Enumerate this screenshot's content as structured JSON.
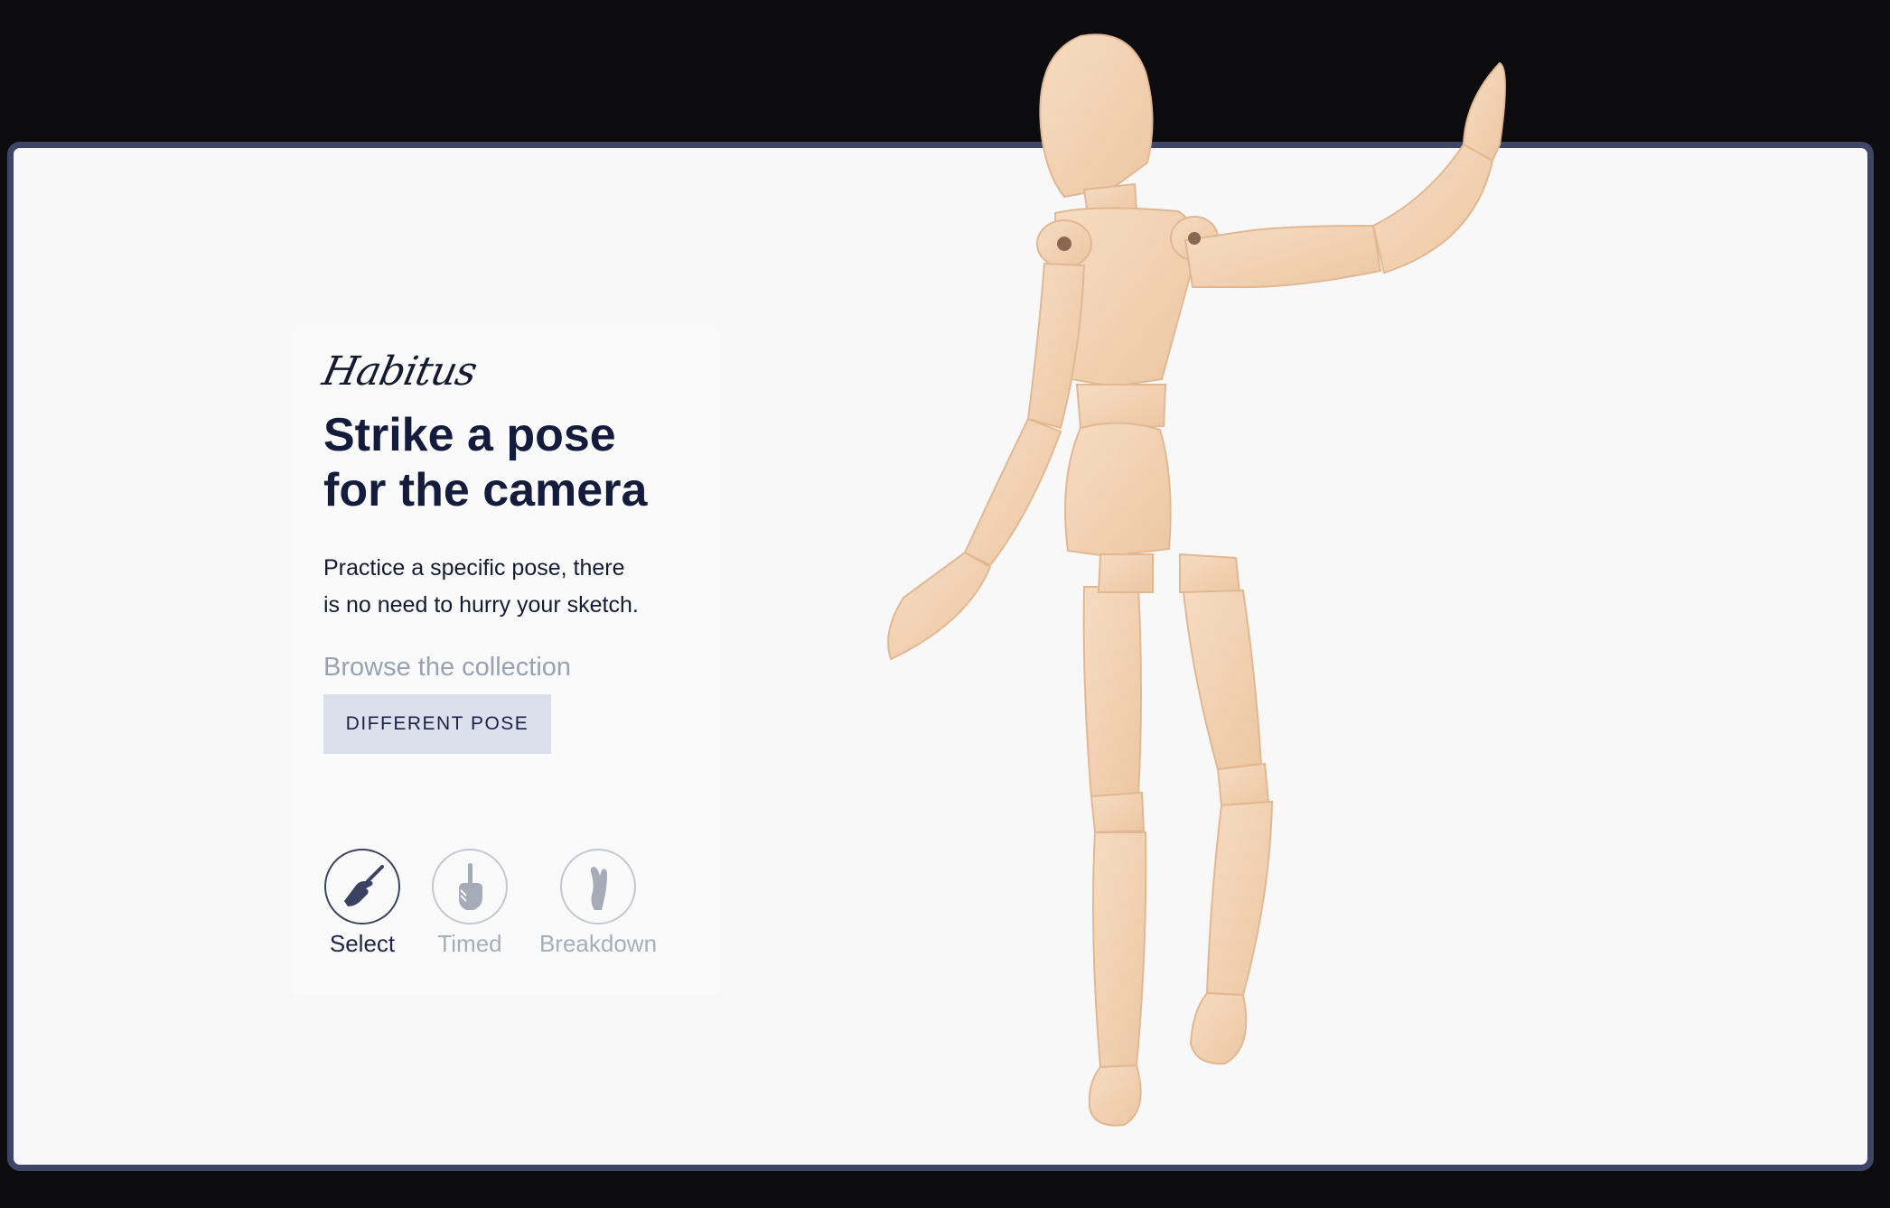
{
  "brand": "Habitus",
  "hero": {
    "headline_line1": "Strike a pose",
    "headline_line2": "for the camera",
    "description_line1": "Practice a specific pose, there",
    "description_line2": "is no need to hurry your sketch.",
    "browse_link": "Browse the collection",
    "button_label": "DIFFERENT POSE"
  },
  "modes": [
    {
      "label": "Select",
      "icon": "hand-pencil-icon",
      "active": true
    },
    {
      "label": "Timed",
      "icon": "hand-timer-icon",
      "active": false
    },
    {
      "label": "Breakdown",
      "icon": "hand-breakdown-icon",
      "active": false
    }
  ],
  "colors": {
    "accent": "#131c3d",
    "panel_border": "#3e4566",
    "button_bg": "#dce0ec",
    "muted": "#9aa1b2",
    "wood": "#f3d3b4"
  }
}
